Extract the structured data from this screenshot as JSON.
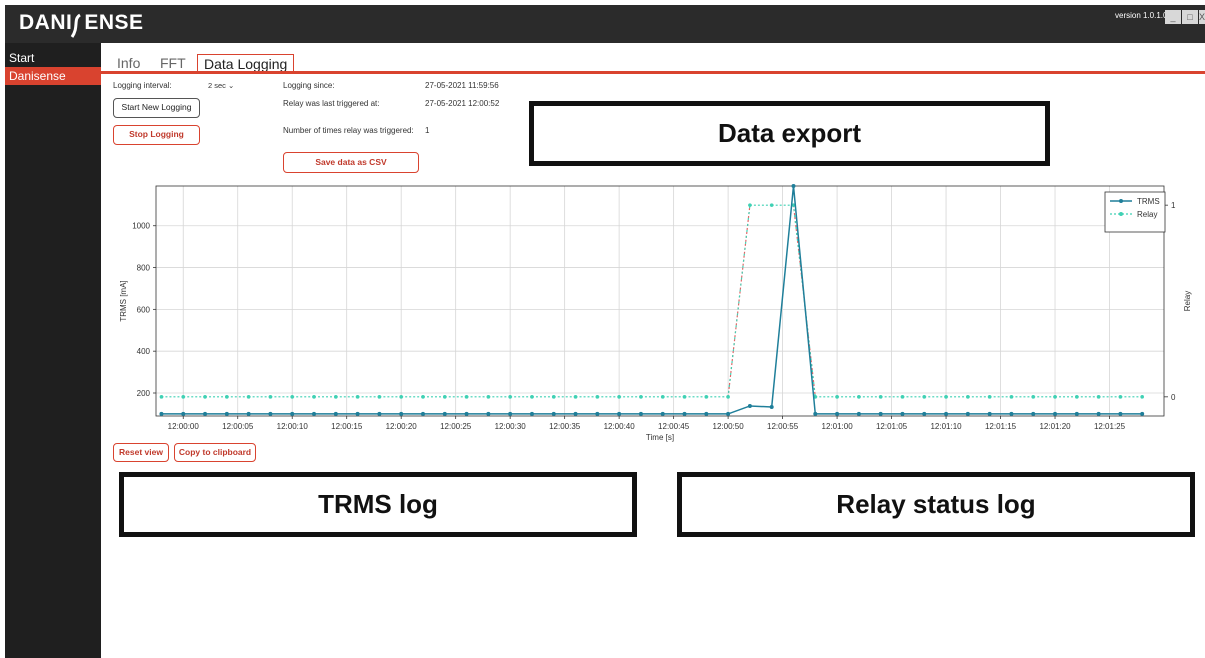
{
  "app": {
    "logo_left": "DANI",
    "logo_right": "ENSE",
    "version": "version 1.0.1.0",
    "window_buttons": [
      "_",
      "□",
      "X"
    ]
  },
  "sidebar": {
    "items": [
      {
        "label": "Start",
        "active": false
      },
      {
        "label": "Danisense",
        "active": true
      }
    ]
  },
  "tabs": [
    {
      "label": "Info",
      "active": false
    },
    {
      "label": "FFT",
      "active": false
    },
    {
      "label": "Data Logging",
      "active": true
    }
  ],
  "logging": {
    "interval_label": "Logging interval:",
    "interval_value": "2 sec",
    "start_button": "Start New Logging",
    "stop_button": "Stop Logging",
    "since_label": "Logging since:",
    "since_value": "27-05-2021 11:59:56",
    "relay_last_label": "Relay was last triggered at:",
    "relay_last_value": "27-05-2021 12:00:52",
    "count_label": "Number of times relay was triggered:",
    "count_value": "1",
    "save_button": "Save data as CSV"
  },
  "callouts": {
    "data_export": "Data export",
    "trms_log": "TRMS log",
    "relay_log": "Relay status log"
  },
  "chart_buttons": {
    "reset": "Reset view",
    "copy": "Copy to clipboard"
  },
  "chart_data": {
    "type": "line",
    "xlabel": "Time [s]",
    "ylabel_left": "TRMS [mA]",
    "ylabel_right": "Relay",
    "x_ticks": [
      "12:00:00",
      "12:00:05",
      "12:00:10",
      "12:00:15",
      "12:00:20",
      "12:00:25",
      "12:00:30",
      "12:00:35",
      "12:00:40",
      "12:00:45",
      "12:00:50",
      "12:00:55",
      "12:01:00",
      "12:01:05",
      "12:01:10",
      "12:01:15",
      "12:01:20",
      "12:01:25"
    ],
    "y_left_ticks": [
      200,
      400,
      600,
      800,
      1000
    ],
    "y_right_ticks": [
      0,
      1
    ],
    "ylim_left": [
      90,
      1190
    ],
    "ylim_right": [
      -0.1,
      1.1
    ],
    "xlim_seconds_from_tick0": [
      -2.5,
      90
    ],
    "legend": [
      "TRMS",
      "Relay"
    ],
    "legend_position": "top-right",
    "grid": true,
    "colors": {
      "trms": "#1f7f9a",
      "relay": "#3fd1b4",
      "relay_transition": "#e06666"
    },
    "series": [
      {
        "name": "TRMS",
        "x": [
          -2,
          0,
          2,
          4,
          6,
          8,
          10,
          12,
          14,
          16,
          18,
          20,
          22,
          24,
          26,
          28,
          30,
          32,
          34,
          36,
          38,
          40,
          42,
          44,
          46,
          48,
          50,
          52,
          54,
          56,
          58,
          60,
          62,
          64,
          66,
          68,
          70,
          72,
          74,
          76,
          78,
          80,
          82,
          84,
          86,
          88
        ],
        "values": [
          100,
          100,
          100,
          100,
          100,
          100,
          100,
          100,
          100,
          100,
          100,
          100,
          100,
          100,
          100,
          100,
          100,
          100,
          100,
          100,
          100,
          100,
          100,
          100,
          100,
          100,
          100,
          138,
          133,
          1190,
          100,
          100,
          100,
          100,
          100,
          100,
          100,
          100,
          100,
          100,
          100,
          100,
          100,
          100,
          100,
          100
        ]
      },
      {
        "name": "Relay",
        "x": [
          -2,
          0,
          2,
          4,
          6,
          8,
          10,
          12,
          14,
          16,
          18,
          20,
          22,
          24,
          26,
          28,
          30,
          32,
          34,
          36,
          38,
          40,
          42,
          44,
          46,
          48,
          50,
          52,
          54,
          56,
          58,
          60,
          62,
          64,
          66,
          68,
          70,
          72,
          74,
          76,
          78,
          80,
          82,
          84,
          86,
          88
        ],
        "values": [
          0,
          0,
          0,
          0,
          0,
          0,
          0,
          0,
          0,
          0,
          0,
          0,
          0,
          0,
          0,
          0,
          0,
          0,
          0,
          0,
          0,
          0,
          0,
          0,
          0,
          0,
          0,
          1,
          1,
          1,
          0,
          0,
          0,
          0,
          0,
          0,
          0,
          0,
          0,
          0,
          0,
          0,
          0,
          0,
          0,
          0
        ]
      }
    ]
  }
}
